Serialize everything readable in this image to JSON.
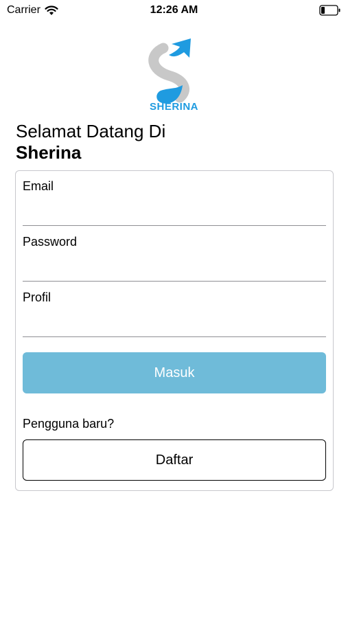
{
  "status_bar": {
    "carrier": "Carrier",
    "time": "12:26 AM",
    "icons": [
      "wifi-icon",
      "battery-icon"
    ]
  },
  "logo": {
    "text": "SHERINA",
    "colors": {
      "blue": "#1f9be0",
      "gray": "#c8c8c8"
    }
  },
  "header": {
    "welcome": "Selamat Datang Di",
    "app_name": "Sherina"
  },
  "form": {
    "email_label": "Email",
    "email_value": "",
    "password_label": "Password",
    "password_value": "",
    "profile_label": "Profil",
    "profile_value": "",
    "login_label": "Masuk",
    "new_user_text": "Pengguna baru?",
    "register_label": "Daftar"
  },
  "colors": {
    "login_button": "#6fbbd9",
    "card_border": "#c7c7cc"
  }
}
